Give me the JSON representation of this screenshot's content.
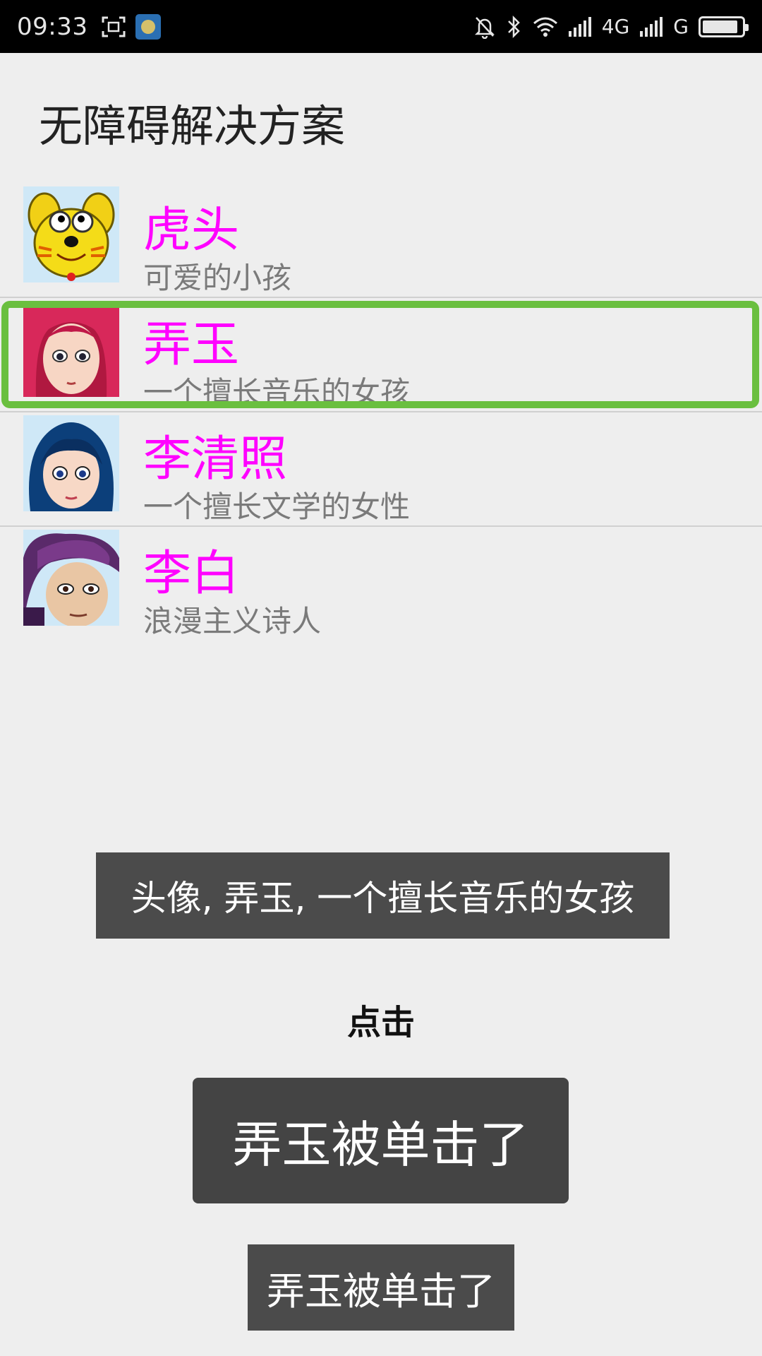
{
  "status_bar": {
    "time": "09:33",
    "network_1": "4G",
    "network_2": "G",
    "battery_level": 0.9
  },
  "page": {
    "title": "无障碍解决方案"
  },
  "list": {
    "items": [
      {
        "name": "虎头",
        "desc": "可爱的小孩",
        "avatar": "tiger-avatar"
      },
      {
        "name": "弄玉",
        "desc": "一个擅长音乐的女孩",
        "avatar": "red-hair-girl-avatar"
      },
      {
        "name": "李清照",
        "desc": "一个擅长文学的女性",
        "avatar": "blue-hair-woman-avatar"
      },
      {
        "name": "李白",
        "desc": "浪漫主义诗人",
        "avatar": "purple-hat-man-avatar"
      }
    ]
  },
  "overlays": {
    "accessibility_announcement": "头像, 弄玉, 一个擅长音乐的女孩",
    "gesture_hint": "点击",
    "toast_large": "弄玉被单击了",
    "toast_small": "弄玉被单击了"
  },
  "colors": {
    "name_color": "#ff00ff",
    "focus_color": "#6abf3f"
  }
}
